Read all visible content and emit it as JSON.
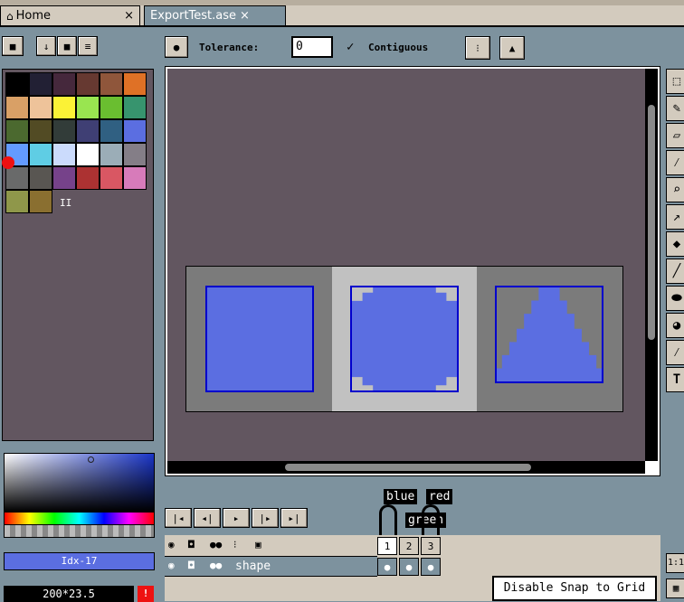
{
  "tabs": [
    {
      "label": "Home",
      "close": "×",
      "active": false
    },
    {
      "label": "ExportTest.ase",
      "close": "×",
      "active": true
    }
  ],
  "toolbar": {
    "tolerance_label": "Tolerance:",
    "tolerance_value": "0",
    "contiguous_label": "Contiguous",
    "contiguous_check": "✓"
  },
  "palette": {
    "colors": [
      "#000000",
      "#222034",
      "#45283c",
      "#663931",
      "#8f563b",
      "#df7126",
      "#d9a066",
      "#eec39a",
      "#fbf236",
      "#99e550",
      "#6abe30",
      "#37946e",
      "#4b692f",
      "#524b24",
      "#323c39",
      "#3f3f74",
      "#306082",
      "#5b6ee1",
      "#639bff",
      "#5fcde4",
      "#cbdbfc",
      "#ffffff",
      "#9badb7",
      "#847e87",
      "#696a6a",
      "#595652",
      "#76428a",
      "#ac3232",
      "#d95763",
      "#d77bba",
      "#8f974a",
      "#8a6f30"
    ],
    "more": "II"
  },
  "color_bar": {
    "index_label": "Idx-17",
    "fg_color": "#5b6ee1"
  },
  "status": {
    "position": "200*23.5",
    "warning": "!",
    "snap_label": "Disable Snap to Grid",
    "zoom": "1:1"
  },
  "timeline": {
    "frames": [
      "1",
      "2",
      "3"
    ],
    "layer_name": "shape",
    "tags": [
      "blue",
      "red",
      "green"
    ]
  },
  "canvas": {
    "bg_color": "#625660",
    "sprite_fill": "#5b6ee1",
    "sprite_border": "#0000cc"
  },
  "icons": {
    "home": "🏠",
    "lock": "🔒",
    "eye": "👁"
  }
}
